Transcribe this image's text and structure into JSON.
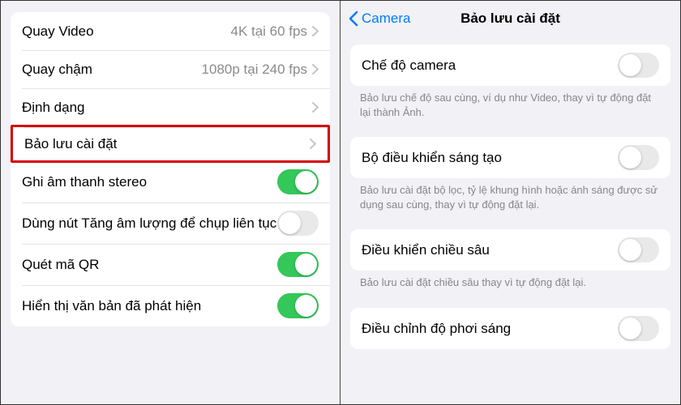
{
  "left": {
    "rows": {
      "video": {
        "label": "Quay Video",
        "value": "4K tại 60 fps"
      },
      "slowmo": {
        "label": "Quay chậm",
        "value": "1080p tại 240 fps"
      },
      "format": {
        "label": "Định dạng"
      },
      "preserve": {
        "label": "Bảo lưu cài đặt"
      },
      "stereo": {
        "label": "Ghi âm thanh stereo"
      },
      "volburst": {
        "label": "Dùng nút Tăng âm lượng để chụp liên tục"
      },
      "qr": {
        "label": "Quét mã QR"
      },
      "detectedtext": {
        "label": "Hiển thị văn bản đã phát hiện"
      }
    }
  },
  "right": {
    "back": "Camera",
    "title": "Bảo lưu cài đặt",
    "items": {
      "cameraMode": {
        "label": "Chế độ camera",
        "caption": "Bảo lưu chế độ sau cùng, ví dụ như Video, thay vì tự động đặt lại thành Ảnh."
      },
      "creative": {
        "label": "Bộ điều khiển sáng tạo",
        "caption": "Bảo lưu cài đặt bộ lọc, tỷ lệ khung hình hoặc ánh sáng được sử dụng sau cùng, thay vì tự động đặt lại."
      },
      "depth": {
        "label": "Điều khiển chiều sâu",
        "caption": "Bảo lưu cài đặt chiều sâu thay vì tự động đặt lại."
      },
      "exposure": {
        "label": "Điều chỉnh độ phơi sáng"
      }
    }
  }
}
